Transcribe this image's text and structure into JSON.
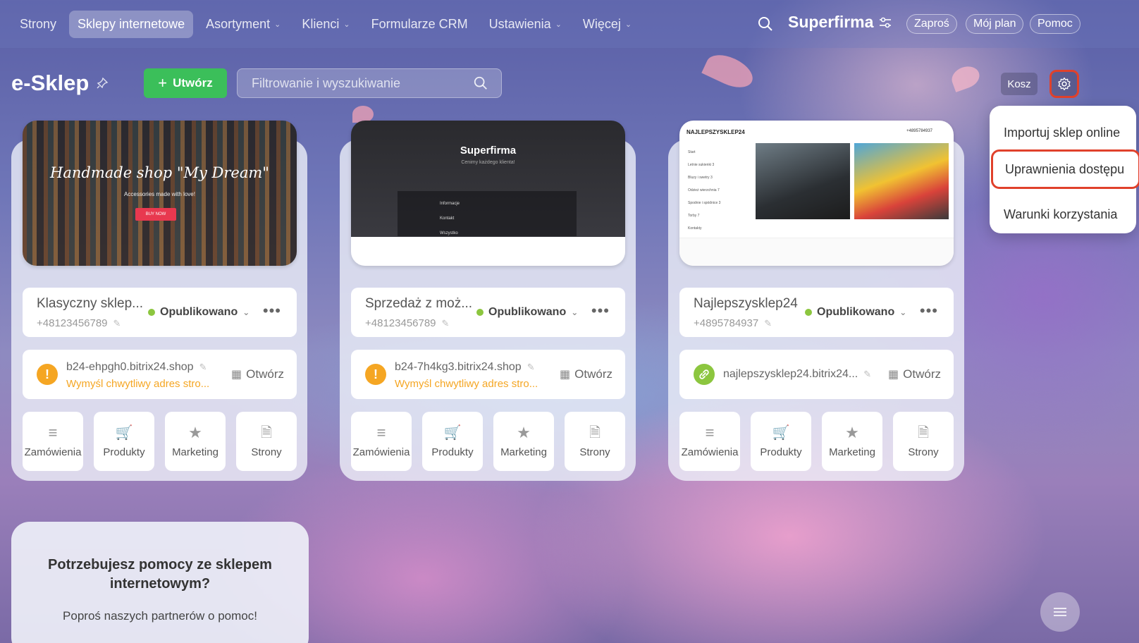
{
  "topnav": {
    "items": [
      {
        "label": "Strony",
        "active": false,
        "has_menu": false
      },
      {
        "label": "Sklepy internetowe",
        "active": true,
        "has_menu": false
      },
      {
        "label": "Asortyment",
        "active": false,
        "has_menu": true
      },
      {
        "label": "Klienci",
        "active": false,
        "has_menu": true
      },
      {
        "label": "Formularze CRM",
        "active": false,
        "has_menu": false
      },
      {
        "label": "Ustawienia",
        "active": false,
        "has_menu": true
      },
      {
        "label": "Więcej",
        "active": false,
        "has_menu": true
      }
    ],
    "brand": "Superfirma",
    "invite_label": "Zaproś",
    "plan_label": "Mój plan",
    "help_label": "Pomoc"
  },
  "toolbar": {
    "title": "e-Sklep",
    "create_label": "Utwórz",
    "search_placeholder": "Filtrowanie i wyszukiwanie",
    "trash_label": "Kosz"
  },
  "settings_menu": {
    "items": [
      {
        "label": "Importuj sklep online",
        "highlighted": false
      },
      {
        "label": "Uprawnienia dostępu",
        "highlighted": true
      },
      {
        "label": "Warunki korzystania",
        "highlighted": false
      }
    ]
  },
  "shops": [
    {
      "name": "Klasyczny sklep...",
      "phone": "+48123456789",
      "status": "Opublikowano",
      "domain": "b24-ehpgh0.bitrix24.shop",
      "domain_warning": "Wymyśl chwytliwy adres stro...",
      "has_warning": true,
      "open_label": "Otwórz",
      "preview": {
        "title": "Handmade shop \"My Dream\"",
        "subtitle": "Accessories made with love!",
        "button": "BUY NOW"
      }
    },
    {
      "name": "Sprzedaż z moż...",
      "phone": "+48123456789",
      "status": "Opublikowano",
      "domain": "b24-7h4kg3.bitrix24.shop",
      "domain_warning": "Wymyśl chwytliwy adres stro...",
      "has_warning": true,
      "open_label": "Otwórz",
      "preview": {
        "title": "Superfirma",
        "subtitle": "Cenimy każdego klienta!",
        "menu": [
          "Informacje",
          "Kontakt",
          "Wszystko"
        ]
      }
    },
    {
      "name": "Najlepszysklep24",
      "phone": "+4895784937",
      "status": "Opublikowano",
      "domain": "najlepszysklep24.bitrix24...",
      "domain_warning": "",
      "has_warning": false,
      "open_label": "Otwórz",
      "preview": {
        "title": "NAJLEPSZYSKLEP24",
        "phone": "+4895784937",
        "menu": [
          "Start",
          "Letnie sukienki 3",
          "Bluzy i swetry 3",
          "Odzież wierzchnia 7",
          "Spodnie i spódnice 3",
          "Torby 7",
          "Kontakty"
        ]
      }
    }
  ],
  "tiles": [
    "Zamówienia",
    "Produkty",
    "Marketing",
    "Strony"
  ],
  "help": {
    "title": "Potrzebujesz pomocy ze sklepem internetowym?",
    "subtitle": "Poproś naszych partnerów o pomoc!"
  },
  "colors": {
    "accent_green": "#3bbf5a",
    "highlight_red": "#e0412b",
    "status_green": "#8cc63f",
    "warning_orange": "#f5a623"
  }
}
